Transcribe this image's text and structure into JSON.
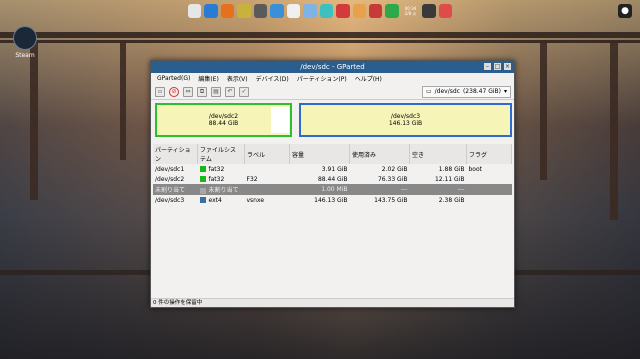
{
  "desktop": {
    "steam_label": "Steam",
    "dock_colors": [
      "#e6e6e6",
      "#2a7bd4",
      "#e5701e",
      "#c9b23c",
      "#5a5a5a",
      "#3a8fd8",
      "#f0f0f0",
      "#7fb3e6",
      "#3fc0c0",
      "#d33a3a",
      "#e8a04a",
      "#c83a3a",
      "#2da84b",
      "#3a3a3a",
      "#e04a4a"
    ],
    "clock": "00:34",
    "clock_sub": "2/8 火"
  },
  "window": {
    "title": "/dev/sdc - GParted",
    "menu": [
      "GParted(G)",
      "編集(E)",
      "表示(V)",
      "デバイス(D)",
      "パーティション(P)",
      "ヘルプ(H)"
    ],
    "device_selector": "/dev/sdc",
    "device_size": "(238.47 GiB)",
    "map": [
      {
        "name": "/dev/sdc2",
        "size": "88.44 GiB",
        "fraction": 0.37,
        "selected": true
      },
      {
        "name": "/dev/sdc3",
        "size": "146.13 GiB",
        "fraction": 0.61,
        "selected": false
      }
    ],
    "columns": [
      "パーティション",
      "ファイルシステム",
      "ラベル",
      "容量",
      "使用済み",
      "空き",
      "フラグ"
    ],
    "rows": [
      {
        "partition": "/dev/sdc1",
        "fs": "fat32",
        "fs_color": "#18b818",
        "label": "",
        "size": "3.91 GiB",
        "used": "2.02 GiB",
        "free": "1.88 GiB",
        "flags": "boot",
        "unallocated": false
      },
      {
        "partition": "/dev/sdc2",
        "fs": "fat32",
        "fs_color": "#18b818",
        "label": "F32",
        "size": "88.44 GiB",
        "used": "76.33 GiB",
        "free": "12.11 GiB",
        "flags": "",
        "unallocated": false
      },
      {
        "partition": "未割り当て",
        "fs": "未割り当て",
        "fs_color": "#a8a8a8",
        "label": "",
        "size": "1.00 MiB",
        "used": "---",
        "free": "---",
        "flags": "",
        "unallocated": true
      },
      {
        "partition": "/dev/sdc3",
        "fs": "ext4",
        "fs_color": "#3a6ea5",
        "label": "vsnxe",
        "size": "146.13 GiB",
        "used": "143.75 GiB",
        "free": "2.38 GiB",
        "flags": "",
        "unallocated": false
      }
    ],
    "status": "0 件の操作を保留中"
  }
}
